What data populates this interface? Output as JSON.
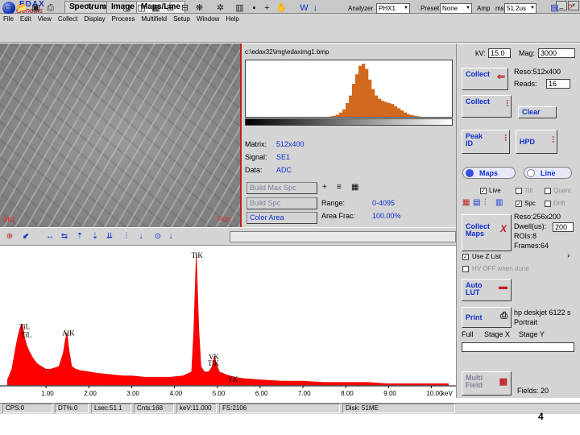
{
  "app": {
    "logo_brand": "EDAX",
    "logo_name": "Genesis"
  },
  "tabs": [
    {
      "label": "Spectrum",
      "active": false
    },
    {
      "label": "Image",
      "active": false
    },
    {
      "label": "Maps/Line",
      "active": true
    }
  ],
  "window_buttons": [
    "_",
    "×"
  ],
  "menu": [
    "File",
    "Edit",
    "View",
    "Collect",
    "Display",
    "Process",
    "Multifield",
    "Setup",
    "Window",
    "Help"
  ],
  "toolbar": {
    "analyzer_label": "Analyzer",
    "analyzer_value": "PHX1",
    "preset_label": "Preset",
    "preset_value": "None",
    "amp_label": "Amp",
    "amp_unit": "ms",
    "amp_value": "51.2us",
    "drop_arrow": "▾"
  },
  "image": {
    "marker_left": "SE1",
    "marker_right": "FOV"
  },
  "map_panel": {
    "path": "c:\\edax32\\img\\edaximg1.bmp",
    "matrix_label": "Matrix:",
    "matrix_value": "512x400",
    "signal_label": "Signal:",
    "signal_value": "SE1",
    "data_label": "Data:",
    "data_value": "ADC",
    "build_max_label": "Build Max Spc",
    "build_spc_label": "Build Spc",
    "color_area_label": "Color Area",
    "range_label": "Range:",
    "range_value": "0-4095",
    "area_frac_label": "Area Frac:",
    "area_frac_value": "100.00%"
  },
  "right_panel": {
    "kv_label": "kV:",
    "kv_value": "15.0",
    "mag_label": "Mag:",
    "mag_value": "3000",
    "collect_image_label": "Collect",
    "reso_label": "Reso:512x400",
    "reads_label": "Reads:",
    "reads_value": "16",
    "collect_spc_label": "Collect",
    "clear_label": "Clear",
    "peak_id_line1": "Peak",
    "peak_id_line2": "ID",
    "hpd_label": "HPD",
    "maps_label": "Maps",
    "line_label": "Line",
    "live_label": "Live",
    "tilt_label": "Tilt",
    "quant_label": "Quant",
    "spc_label": "Spc",
    "drift_label": "Drift",
    "map_reso": "Reso:256x200",
    "dwell_label": "Dwell(us):",
    "dwell_value": "200",
    "roi_label": "ROIs:8",
    "frames_label": "Frames:64",
    "collect_maps_line1": "Collect",
    "collect_maps_line2": "Maps",
    "use_z_list": "Use Z List",
    "hv_off": "HV OFF when done",
    "auto_lut_line1": "Auto",
    "auto_lut_line2": "LUT",
    "print_label": "Print",
    "printer_line1": "hp deskjet 6122 s",
    "printer_line2": "Portrait",
    "row_labels": [
      "Full",
      "Stage X",
      "Stage Y"
    ],
    "multi_field_line1": "Multi",
    "multi_field_line2": "Field",
    "fields_label": "Fields: 20"
  },
  "spectrum": {
    "peaks": [
      {
        "label": "TiK",
        "x": 4.51,
        "y": 100
      },
      {
        "label": "TiL",
        "x": 0.45,
        "y": 46
      },
      {
        "label": "TiL",
        "x": 0.45,
        "y": 40
      },
      {
        "label": "AlK",
        "x": 1.49,
        "y": 40
      },
      {
        "label": "VK",
        "x": 4.95,
        "y": 22
      },
      {
        "label": "TiK",
        "x": 4.93,
        "y": 16
      },
      {
        "label": "VK",
        "x": 5.43,
        "y": 6
      }
    ],
    "x_ticks": [
      "1.00",
      "2.00",
      "3.00",
      "4.00",
      "5.00",
      "6.00",
      "7.00",
      "8.00",
      "9.00",
      "10.00"
    ],
    "x_unit": "keV"
  },
  "chart_data": {
    "type": "area",
    "title": "",
    "xlabel": "keV",
    "ylabel": "",
    "xlim": [
      0,
      10.5
    ],
    "ylim": [
      0,
      100
    ],
    "series": [
      {
        "x": [
          0.1,
          0.2,
          0.3,
          0.35,
          0.4,
          0.45,
          0.5,
          0.55,
          0.6,
          0.7,
          0.8,
          0.9,
          1.0,
          1.1,
          1.2,
          1.3,
          1.4,
          1.45,
          1.49,
          1.53,
          1.6,
          1.7,
          1.8,
          2.0,
          2.2,
          2.5,
          2.8,
          3.0,
          3.3,
          3.6,
          3.9,
          4.2,
          4.4,
          4.45,
          4.51,
          4.57,
          4.62,
          4.7,
          4.8,
          4.88,
          4.93,
          4.98,
          5.05,
          5.2,
          5.4,
          5.6,
          6.0,
          6.5,
          7.0,
          7.5,
          8.0,
          8.5,
          9.0,
          9.5,
          10.0,
          10.4
        ],
        "y": [
          4,
          12,
          30,
          38,
          44,
          46,
          36,
          30,
          26,
          20,
          16,
          14,
          12,
          12,
          13,
          14,
          24,
          34,
          40,
          28,
          14,
          12,
          11,
          10,
          9,
          8,
          7,
          7,
          6,
          6,
          6,
          7,
          10,
          40,
          100,
          42,
          14,
          10,
          10,
          14,
          22,
          16,
          10,
          8,
          6,
          5,
          4,
          3,
          3,
          2,
          2,
          2,
          1,
          1,
          1,
          1
        ]
      }
    ]
  },
  "histogram": {
    "bins": [
      0,
      0,
      0,
      0,
      0,
      0,
      0,
      0,
      0,
      0,
      0,
      0,
      0,
      0,
      0,
      0,
      0,
      0,
      0,
      0,
      0,
      0,
      0,
      0,
      0,
      0,
      1,
      2,
      4,
      8,
      14,
      26,
      40,
      62,
      80,
      96,
      100,
      90,
      70,
      52,
      40,
      34,
      30,
      28,
      26,
      24,
      20,
      16,
      12,
      8,
      5,
      3,
      2,
      1,
      0,
      0,
      0,
      0,
      0,
      0,
      0,
      0,
      0,
      0
    ]
  },
  "status": [
    {
      "label": "CPS:0"
    },
    {
      "label": "DT%:0"
    },
    {
      "label": "Lsec:51.1"
    },
    {
      "label": "Cnts:168"
    },
    {
      "label": "keV:11.000"
    },
    {
      "label": "FS:2106"
    },
    {
      "label": "Disk: 51ME"
    }
  ],
  "page_number": "4"
}
